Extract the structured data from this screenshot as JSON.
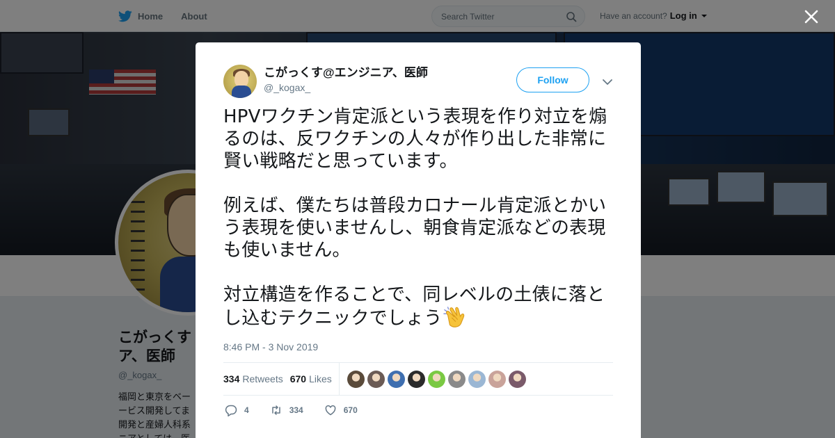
{
  "nav": {
    "home_label": "Home",
    "about_label": "About"
  },
  "search": {
    "placeholder": "Search Twitter"
  },
  "account": {
    "prompt": "Have an account?",
    "login_label": "Log in"
  },
  "profile": {
    "name": "こがっくす@エンジニア、医師",
    "name_line1": "こがっくす",
    "name_line2": "ア、医師",
    "handle": "@_kogax_",
    "bio_partial": "福岡と東京をベー\nービス開発してま\n開発と産婦人科系\nニアとしては、医"
  },
  "tweet": {
    "author_name": "こがっくす@エンジニア、医師",
    "author_handle": "@_kogax_",
    "follow_label": "Follow",
    "text": "HPVワクチン肯定派という表現を作り対立を煽るのは、反ワクチンの人々が作り出した非常に賢い戦略だと思っています。\n\n例えば、僕たちは普段カロナール肯定派とかいう表現を使いませんし、朝食肯定派などの表現も使いません。\n\n対立構造を作ることで、同レベルの土俵に落とし込むテクニックでしょう",
    "emoji": "clapping-hands",
    "timestamp": "8:46 PM - 3 Nov 2019",
    "retweets_count": "334",
    "retweets_label": "Retweets",
    "likes_count": "670",
    "likes_label": "Likes",
    "reply_count": "4",
    "retweet_action_count": "334",
    "like_action_count": "670",
    "liker_avatar_colors": [
      "#5a4a3a",
      "#6b5b55",
      "#3f6fb0",
      "#2b2b2b",
      "#7ac943",
      "#8a8a8a",
      "#9bb7d4",
      "#c9a39a",
      "#7a5a6a"
    ]
  },
  "colors": {
    "accent": "#1da1f2",
    "muted": "#657786",
    "text": "#14171a"
  }
}
